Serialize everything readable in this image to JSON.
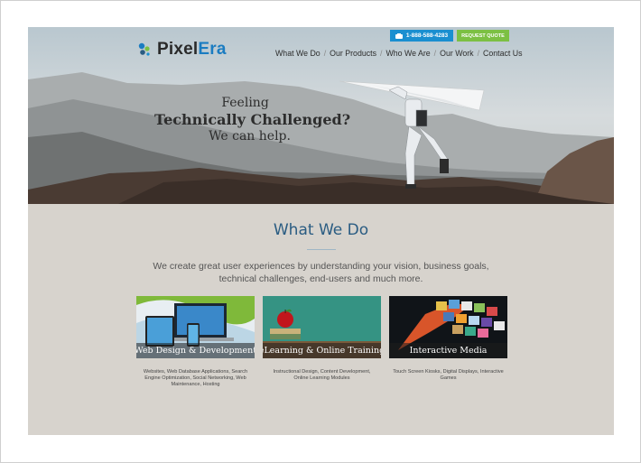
{
  "header": {
    "logo": {
      "part1": "Pixel",
      "part2": "Era"
    },
    "phone": "1-888-588-4283",
    "quote_button": "REQUEST QUOTE",
    "nav": [
      "What We Do",
      "Our Products",
      "Who We Are",
      "Our Work",
      "Contact Us"
    ]
  },
  "hero": {
    "line1": "Feeling",
    "line2": "Technically Challenged?",
    "line3": "We can help."
  },
  "main": {
    "title": "What We Do",
    "intro": "We create great user experiences by understanding your vision, business goals, technical challenges, end-users and much more.",
    "cards": [
      {
        "title": "Web Design & Development",
        "desc": "Websites, Web Database Applications, Search Engine Optimization, Social Networking, Web Maintenance, Hosting"
      },
      {
        "title": "eLearning & Online Training",
        "desc": "Instructional Design, Content Development, Online Learning Modules"
      },
      {
        "title": "Interactive Media",
        "desc": "Touch Screen Kiosks, Digital Displays, Interactive Games"
      }
    ]
  },
  "colors": {
    "brand_blue": "#1b7cc1",
    "phone_button": "#1a8fd0",
    "quote_button": "#7cc043",
    "title_blue": "#2a5c82"
  },
  "icons": {
    "phone": "phone-icon",
    "logo": "logo-mark-icon"
  }
}
